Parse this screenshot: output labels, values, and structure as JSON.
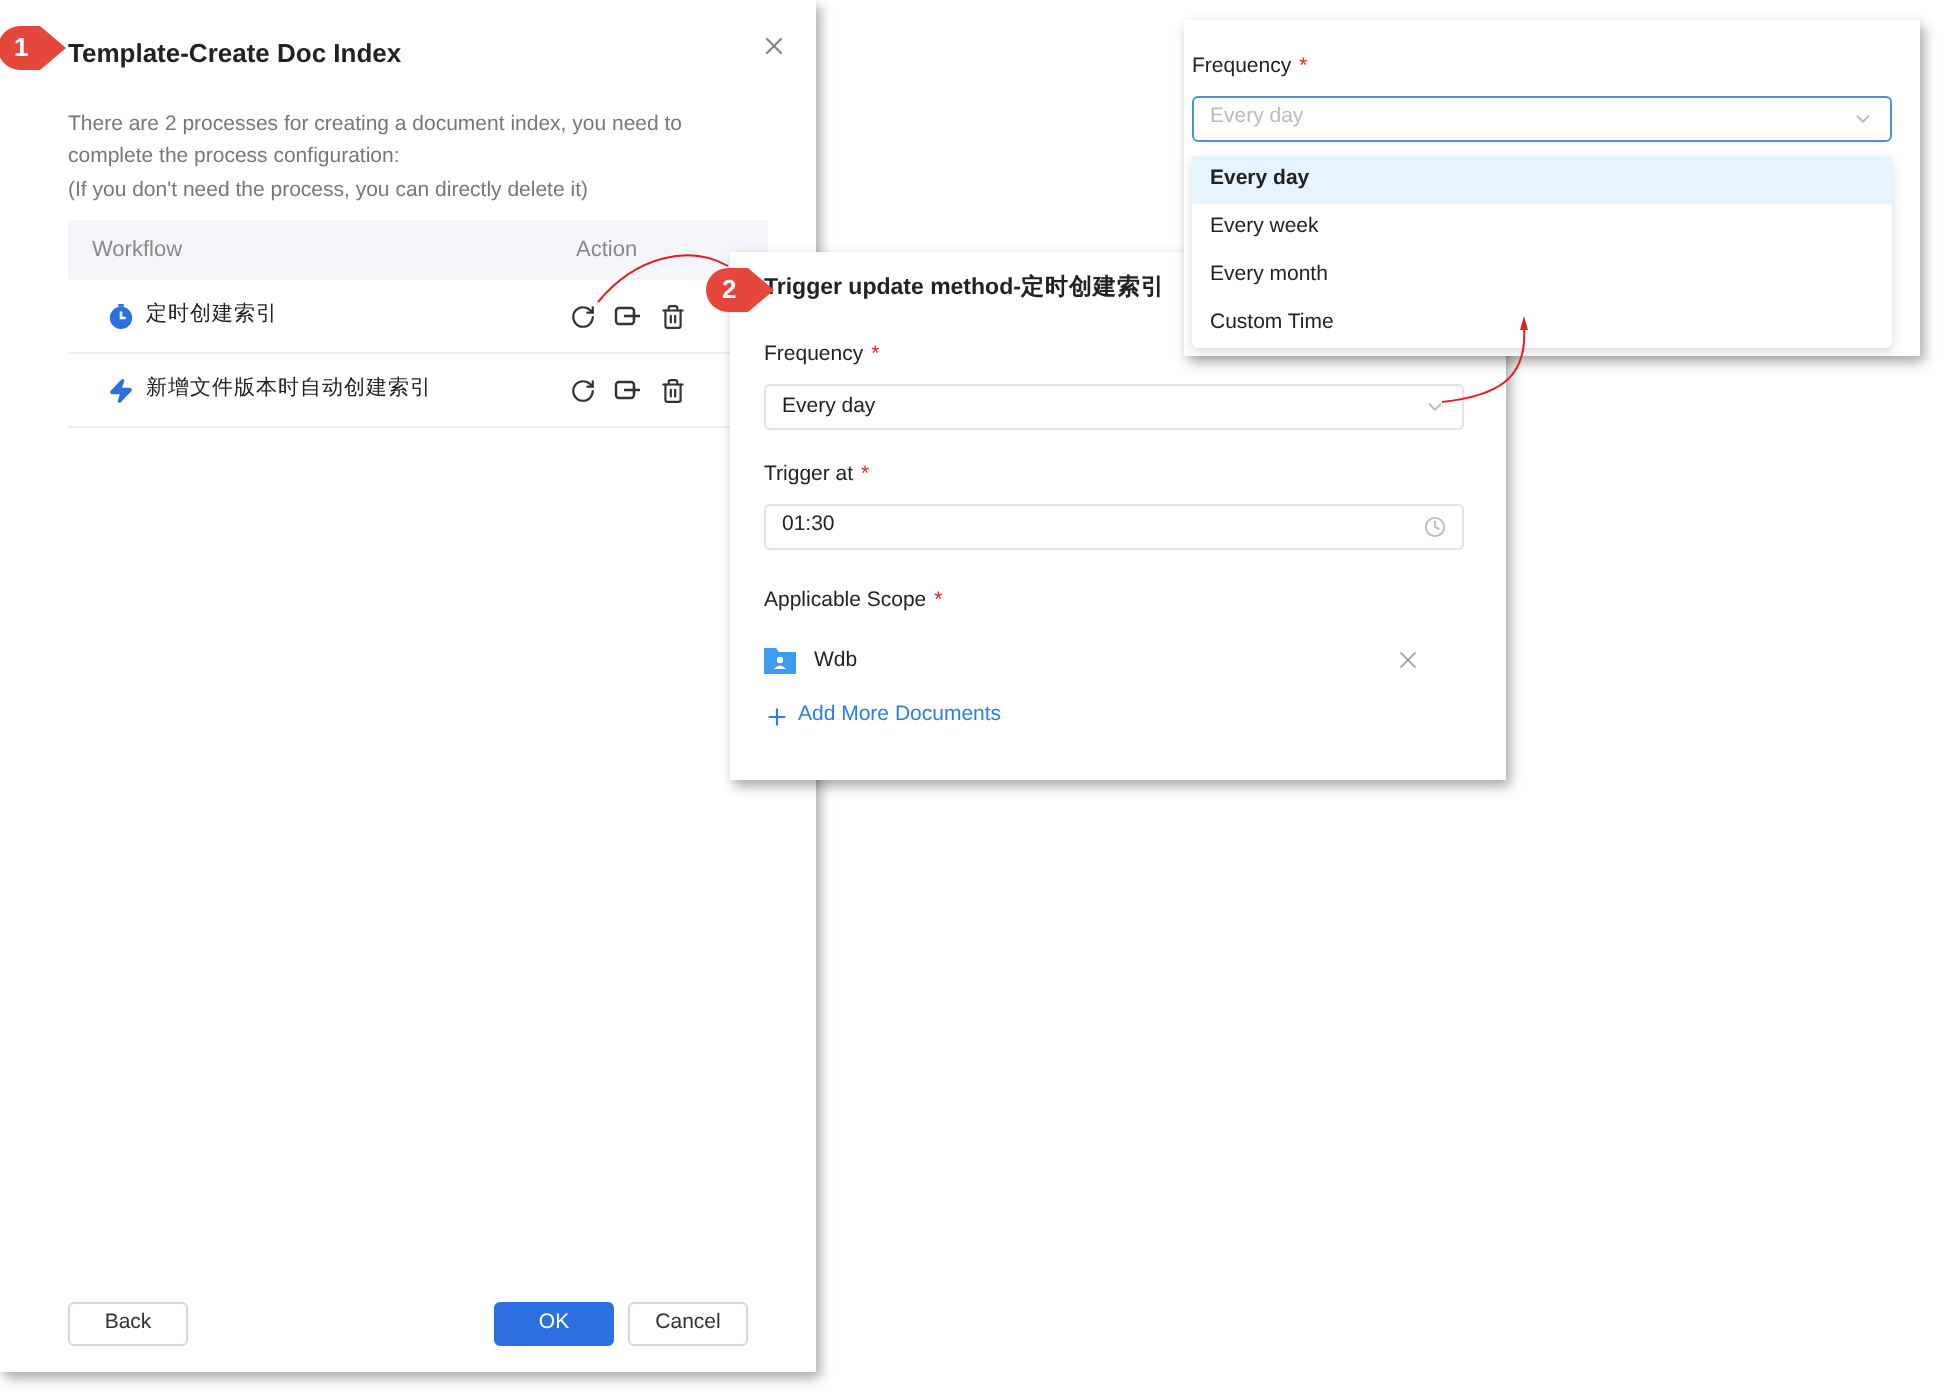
{
  "dialog": {
    "title": "Template-Create Doc Index",
    "description": "There are 2 processes for creating a document index, you need to complete the process configuration:",
    "note": "(If you don't need the process, you can directly delete it)",
    "columns": [
      "Workflow",
      "Action"
    ],
    "rows": [
      {
        "kind": "timer",
        "name": "定时创建索引"
      },
      {
        "kind": "event",
        "name": "新增文件版本时自动创建索引"
      }
    ],
    "buttons": [
      {
        "label": "Back",
        "kind": "secondary"
      },
      {
        "label": "OK",
        "kind": "primary"
      },
      {
        "label": "Cancel",
        "kind": "secondary"
      }
    ]
  },
  "trigger_panel": {
    "title": "Trigger update method-定时创建索引",
    "fields": [
      {
        "kind": "select",
        "label": "Frequency",
        "required_mark": "*",
        "value": "Every day"
      },
      {
        "kind": "time",
        "label": "Trigger at",
        "required_mark": "*",
        "value": "01:30"
      }
    ],
    "scope": {
      "label": "Applicable Scope",
      "required_mark": "*",
      "items": [
        {
          "name": "Wdb"
        }
      ],
      "add_link": "Add More Documents"
    }
  },
  "dropdown_panel": {
    "label": "Frequency",
    "required_mark": "*",
    "placeholder": "Every day",
    "options": [
      {
        "label": "Every day",
        "selected": true
      },
      {
        "label": "Every week",
        "selected": false
      },
      {
        "label": "Every month",
        "selected": false
      },
      {
        "label": "Custom Time",
        "selected": false
      }
    ]
  },
  "callouts": [
    {
      "number": "1"
    },
    {
      "number": "2"
    }
  ]
}
